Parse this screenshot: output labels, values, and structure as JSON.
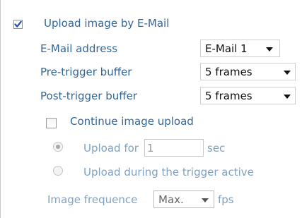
{
  "upload_by_email": {
    "label": "Upload image by E-Mail",
    "checked": true
  },
  "email_address": {
    "label": "E-Mail address",
    "value": "E-Mail 1"
  },
  "pre_trigger": {
    "label": "Pre-trigger buffer",
    "value": "5  frames"
  },
  "post_trigger": {
    "label": "Post-trigger buffer",
    "value": "5  frames"
  },
  "continue_upload": {
    "label": "Continue image upload",
    "checked": false
  },
  "upload_for": {
    "label": "Upload for",
    "value": "1",
    "unit": "sec",
    "selected": true
  },
  "upload_during": {
    "label": "Upload during the trigger active",
    "selected": false
  },
  "image_frequence": {
    "label": "Image frequence",
    "value": "Max.",
    "unit": "fps"
  },
  "colors": {
    "label_blue": "#336699",
    "disabled_blue": "#7fa2c4",
    "check_blue": "#1f4fa8"
  }
}
